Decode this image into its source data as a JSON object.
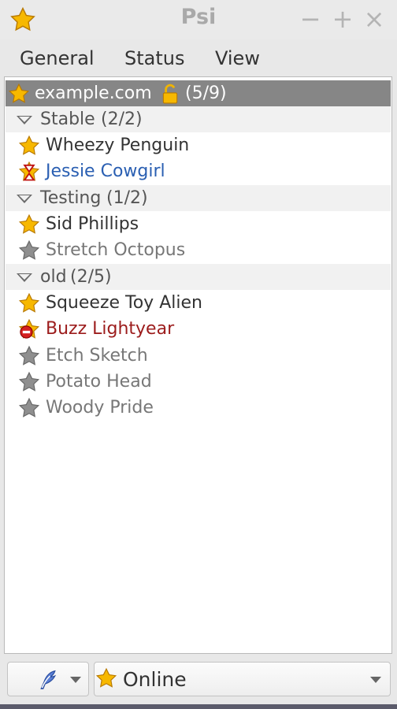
{
  "window": {
    "title": "Psi",
    "controls": [
      "−",
      "+",
      "×"
    ],
    "icon": "star-icon"
  },
  "menu": {
    "items": [
      "General",
      "Status",
      "View"
    ]
  },
  "roster": {
    "account": {
      "label": "example.com",
      "count": "(5/9)",
      "lock_icon": "lock-open-icon"
    },
    "groups": [
      {
        "name": "Stable",
        "count": "(2/2)",
        "contacts": [
          {
            "name": "Wheezy Penguin",
            "status": "online"
          },
          {
            "name": "Jessie Cowgirl",
            "status": "away"
          }
        ]
      },
      {
        "name": "Testing",
        "count": "(1/2)",
        "contacts": [
          {
            "name": "Sid Phillips",
            "status": "online"
          },
          {
            "name": "Stretch Octopus",
            "status": "offline"
          }
        ]
      },
      {
        "name": "old",
        "count": "(2/5)",
        "contacts": [
          {
            "name": "Squeeze Toy Alien",
            "status": "online"
          },
          {
            "name": "Buzz Lightyear",
            "status": "dnd"
          },
          {
            "name": "Etch Sketch",
            "status": "offline"
          },
          {
            "name": "Potato Head",
            "status": "offline"
          },
          {
            "name": "Woody Pride",
            "status": "offline"
          }
        ]
      }
    ]
  },
  "statusbar": {
    "event_icon": "feather-icon",
    "status_label": "Online"
  },
  "colors": {
    "star_online": "#f5b400",
    "star_offline": "#8f8f8f",
    "away_text": "#2a5fb2",
    "dnd_text": "#9c1c1c"
  }
}
